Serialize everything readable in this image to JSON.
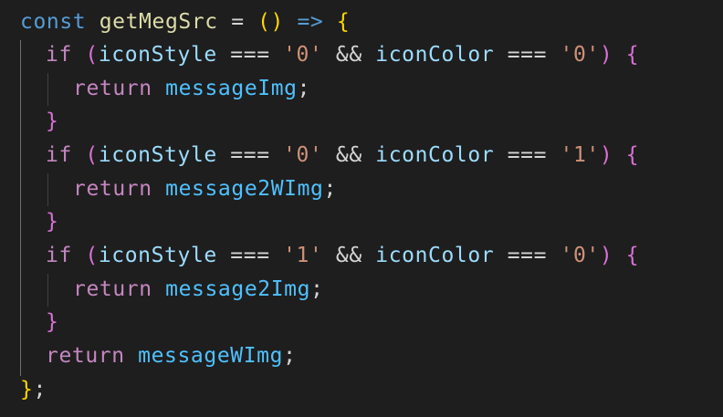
{
  "code": {
    "l1": {
      "kw": "const",
      "name": "getMegSrc",
      "eq": "=",
      "paren_open": "(",
      "paren_close": ")",
      "arrow": "=>",
      "brace": "{"
    },
    "l2": {
      "kw": "if",
      "open": "(",
      "var1": "iconStyle",
      "op1": "===",
      "str1": "'0'",
      "and": "&&",
      "var2": "iconColor",
      "op2": "===",
      "str2": "'0'",
      "close": ")",
      "brace": "{"
    },
    "l3": {
      "kw": "return",
      "value": "messageImg",
      "semi": ";"
    },
    "l4": {
      "brace": "}"
    },
    "l5": {
      "kw": "if",
      "open": "(",
      "var1": "iconStyle",
      "op1": "===",
      "str1": "'0'",
      "and": "&&",
      "var2": "iconColor",
      "op2": "===",
      "str2": "'1'",
      "close": ")",
      "brace": "{"
    },
    "l6": {
      "kw": "return",
      "value": "message2WImg",
      "semi": ";"
    },
    "l7": {
      "brace": "}"
    },
    "l8": {
      "kw": "if",
      "open": "(",
      "var1": "iconStyle",
      "op1": "===",
      "str1": "'1'",
      "and": "&&",
      "var2": "iconColor",
      "op2": "===",
      "str2": "'0'",
      "close": ")",
      "brace": "{"
    },
    "l9": {
      "kw": "return",
      "value": "message2Img",
      "semi": ";"
    },
    "l10": {
      "brace": "}"
    },
    "l11": {
      "kw": "return",
      "value": "messageWImg",
      "semi": ";"
    },
    "l12": {
      "brace": "}",
      "semi": ";"
    }
  },
  "colors": {
    "background": "#1e1e1e",
    "keyword_blue": "#569cd6",
    "keyword_purple": "#c586c0",
    "function": "#dcdcaa",
    "variable": "#9cdcfe",
    "identifier": "#4fc1ff",
    "string": "#ce9178",
    "bracket_level1": "#ffd700",
    "bracket_level2": "#da70d6",
    "bracket_level3": "#179fff"
  }
}
